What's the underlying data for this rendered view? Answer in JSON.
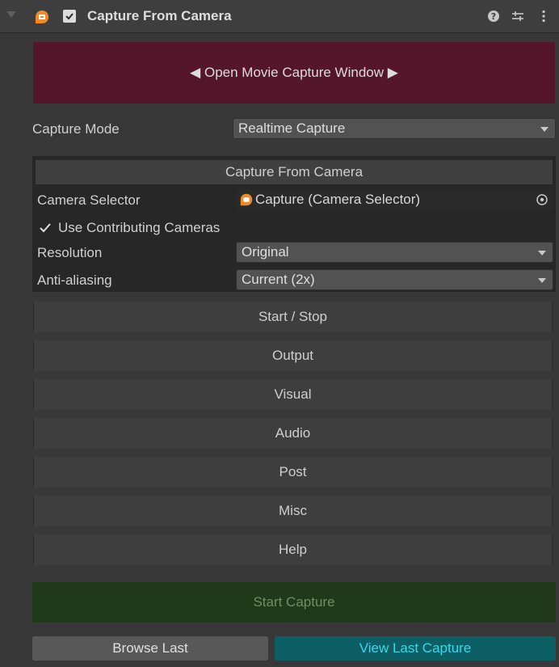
{
  "header": {
    "title": "Capture From Camera",
    "enabled": true,
    "icons": [
      "foldout-arrow-icon",
      "capture-component-icon",
      "help-icon",
      "preset-icon",
      "kebab-menu-icon"
    ]
  },
  "open_window_button": {
    "label": "◀ Open Movie Capture Window ▶"
  },
  "capture_mode": {
    "label": "Capture Mode",
    "value": "Realtime Capture"
  },
  "camera_section": {
    "header": "Capture From Camera",
    "camera_selector": {
      "label": "Camera Selector",
      "value": "Capture (Camera Selector)"
    },
    "use_contributing": {
      "label": "Use Contributing Cameras",
      "checked": true
    },
    "resolution": {
      "label": "Resolution",
      "value": "Original"
    },
    "anti_aliasing": {
      "label": "Anti-aliasing",
      "value": "Current (2x)"
    }
  },
  "sections": [
    {
      "label": "Start / Stop"
    },
    {
      "label": "Output"
    },
    {
      "label": "Visual"
    },
    {
      "label": "Audio"
    },
    {
      "label": "Post"
    },
    {
      "label": "Misc"
    },
    {
      "label": "Help"
    }
  ],
  "actions": {
    "start_capture": "Start Capture",
    "browse_last": "Browse Last",
    "view_last": "View Last Capture"
  },
  "colors": {
    "panel_bg": "#383838",
    "open_window_bg": "#55162b",
    "start_capture_bg": "#1e3a18",
    "view_last_bg": "#0d5f66",
    "view_last_text": "#3fd6e8",
    "icon_orange": "#f08a24"
  }
}
